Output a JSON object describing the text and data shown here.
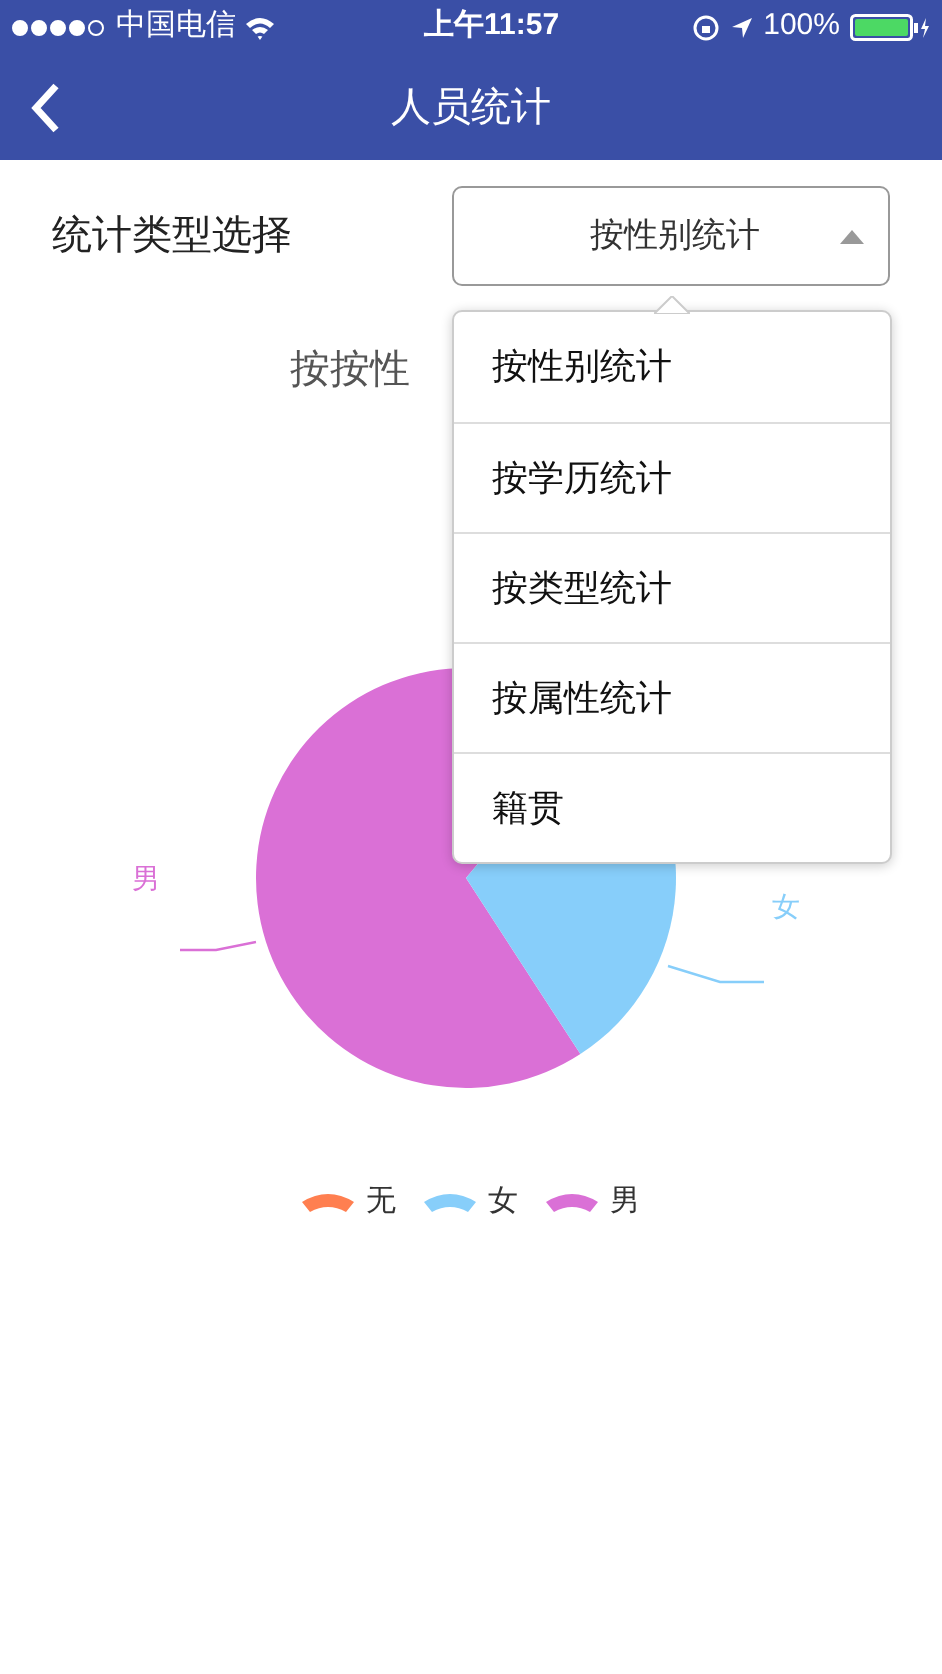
{
  "status_bar": {
    "carrier": "中国电信",
    "time": "上午11:57",
    "battery": "100%"
  },
  "nav": {
    "title": "人员统计"
  },
  "filter": {
    "label": "统计类型选择",
    "value": "按性别统计"
  },
  "dropdown": {
    "options": [
      {
        "label": "按性别统计"
      },
      {
        "label": "按学历统计"
      },
      {
        "label": "按类型统计"
      },
      {
        "label": "按属性统计"
      },
      {
        "label": "籍贯"
      }
    ]
  },
  "chart": {
    "title": "按按性",
    "slice_labels": [
      {
        "label": "男",
        "color": "#da70d6"
      },
      {
        "label": "女",
        "color": "#87cefa"
      }
    ],
    "legend": [
      {
        "label": "无",
        "color": "#ff7f50"
      },
      {
        "label": "女",
        "color": "#87cefa"
      },
      {
        "label": "男",
        "color": "#da70d6"
      }
    ]
  }
}
